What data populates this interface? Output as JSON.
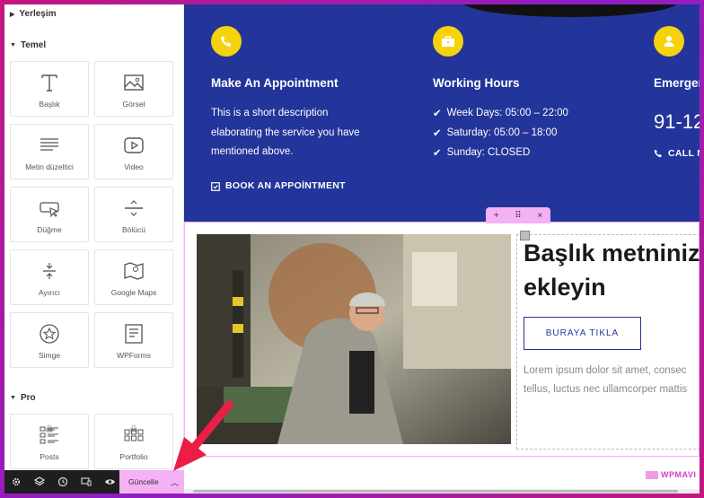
{
  "sidebar": {
    "section_layout": "Yerleşim",
    "section_basic": "Temel",
    "section_pro": "Pro",
    "widgets": [
      {
        "label": "Başlık",
        "icon": "heading-icon"
      },
      {
        "label": "Görsel",
        "icon": "image-icon"
      },
      {
        "label": "Metin düzeltici",
        "icon": "text-editor-icon"
      },
      {
        "label": "Video",
        "icon": "video-icon"
      },
      {
        "label": "Düğme",
        "icon": "button-icon"
      },
      {
        "label": "Bölücü",
        "icon": "divider-icon"
      },
      {
        "label": "Ayırıcı",
        "icon": "spacer-icon"
      },
      {
        "label": "Google Maps",
        "icon": "map-icon"
      },
      {
        "label": "Simge",
        "icon": "star-icon"
      },
      {
        "label": "WPForms",
        "icon": "form-icon"
      }
    ],
    "pro_widgets": [
      {
        "label": "Posts",
        "icon": "posts-icon"
      },
      {
        "label": "Portfolio",
        "icon": "portfolio-icon"
      }
    ],
    "bottom_bar": {
      "update_label": "Güncelle"
    }
  },
  "canvas": {
    "columns": [
      {
        "icon": "phone-icon",
        "title": "Make An Appointment",
        "text_lines": [
          "This is a short description",
          "elaborating the service you have",
          "mentioned above."
        ],
        "link": "BOOK AN APPOİNTMENT"
      },
      {
        "icon": "briefcase-icon",
        "title": "Working Hours",
        "hours": [
          "Week Days: 05:00 – 22:00",
          "Saturday: 05:00 – 18:00",
          "Sunday: CLOSED"
        ]
      },
      {
        "icon": "person-icon",
        "title": "Emergen",
        "number": "91-12",
        "link": "CALL N"
      }
    ],
    "section_controls": {
      "add": "+",
      "move": "⠿",
      "close": "×"
    },
    "heading_lines": [
      "Başlık metniniz",
      "ekleyin"
    ],
    "button_label": "BURAYA TIKLA",
    "lorem_lines": [
      "Lorem ipsum dolor sit amet, consec",
      "tellus, luctus nec ullamcorper mattis"
    ],
    "watermark": "WPMAVI"
  },
  "colors": {
    "brand_blue": "#23359a",
    "icon_yellow": "#f5d30c",
    "editor_pink": "#f4b1f4",
    "arrow_red": "#ea1e46"
  }
}
